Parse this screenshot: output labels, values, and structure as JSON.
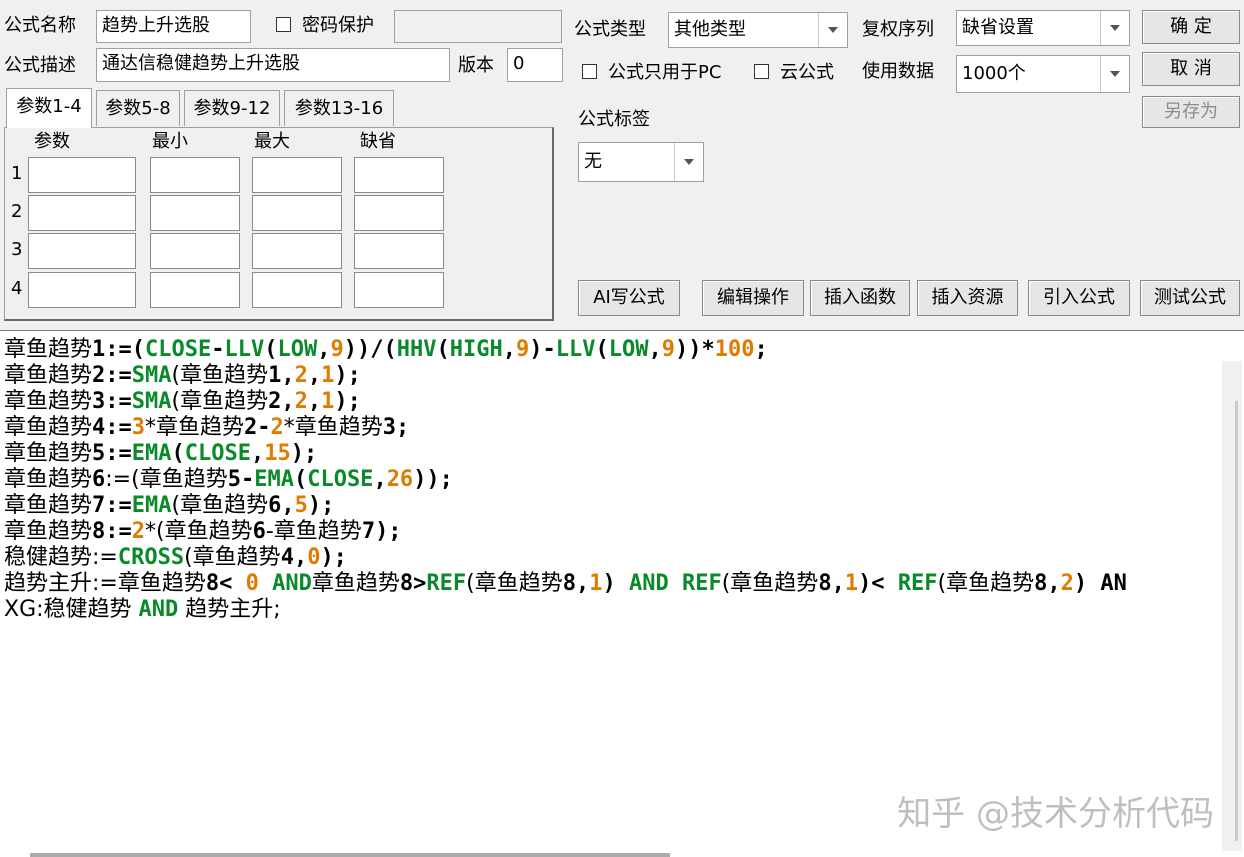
{
  "labels": {
    "formula_name": "公式名称",
    "password": "密码保护",
    "formula_desc": "公式描述",
    "version": "版本",
    "formula_type": "公式类型",
    "rights_seq": "复权序列",
    "pc_only": "公式只用于PC",
    "cloud": "云公式",
    "use_data": "使用数据",
    "formula_tag": "公式标签"
  },
  "fields": {
    "formula_name": "趋势上升选股",
    "password": "",
    "formula_desc": "通达信稳健趋势上升选股",
    "version": "0"
  },
  "selects": {
    "formula_type": "其他类型",
    "rights_seq": "缺省设置",
    "use_data": "1000个",
    "formula_tag": "无"
  },
  "buttons": {
    "ok": "确  定",
    "cancel": "取  消",
    "save_as": "另存为",
    "ai_write": "AI写公式",
    "edit_ops": "编辑操作",
    "insert_func": "插入函数",
    "insert_res": "插入资源",
    "import_formula": "引入公式",
    "test_formula": "测试公式"
  },
  "tabs": [
    "参数1-4",
    "参数5-8",
    "参数9-12",
    "参数13-16"
  ],
  "param_headers": [
    "参数",
    "最小",
    "最大",
    "缺省"
  ],
  "param_rows": [
    "1",
    "2",
    "3",
    "4"
  ],
  "code_lines": [
    "章鱼趋势1:=(CLOSE-LLV(LOW,9))/(HHV(HIGH,9)-LLV(LOW,9))*100;",
    "章鱼趋势2:=SMA(章鱼趋势1,2,1);",
    "章鱼趋势3:=SMA(章鱼趋势2,2,1);",
    "章鱼趋势4:=3*章鱼趋势2-2*章鱼趋势3;",
    "章鱼趋势5:=EMA(CLOSE,15);",
    "章鱼趋势6:=(章鱼趋势5-EMA(CLOSE,26));",
    "章鱼趋势7:=EMA(章鱼趋势6,5);",
    "章鱼趋势8:=2*(章鱼趋势6-章鱼趋势7);",
    "稳健趋势:=CROSS(章鱼趋势4,0);",
    "趋势主升:=章鱼趋势8< 0 AND章鱼趋势8>REF(章鱼趋势8,1) AND REF(章鱼趋势8,1)< REF(章鱼趋势8,2) AN",
    "XG:稳健趋势 AND 趋势主升;"
  ],
  "watermark": "知乎 @技术分析代码",
  "colors": {
    "keyword": "#0a8a2a",
    "number": "#e07b00"
  }
}
